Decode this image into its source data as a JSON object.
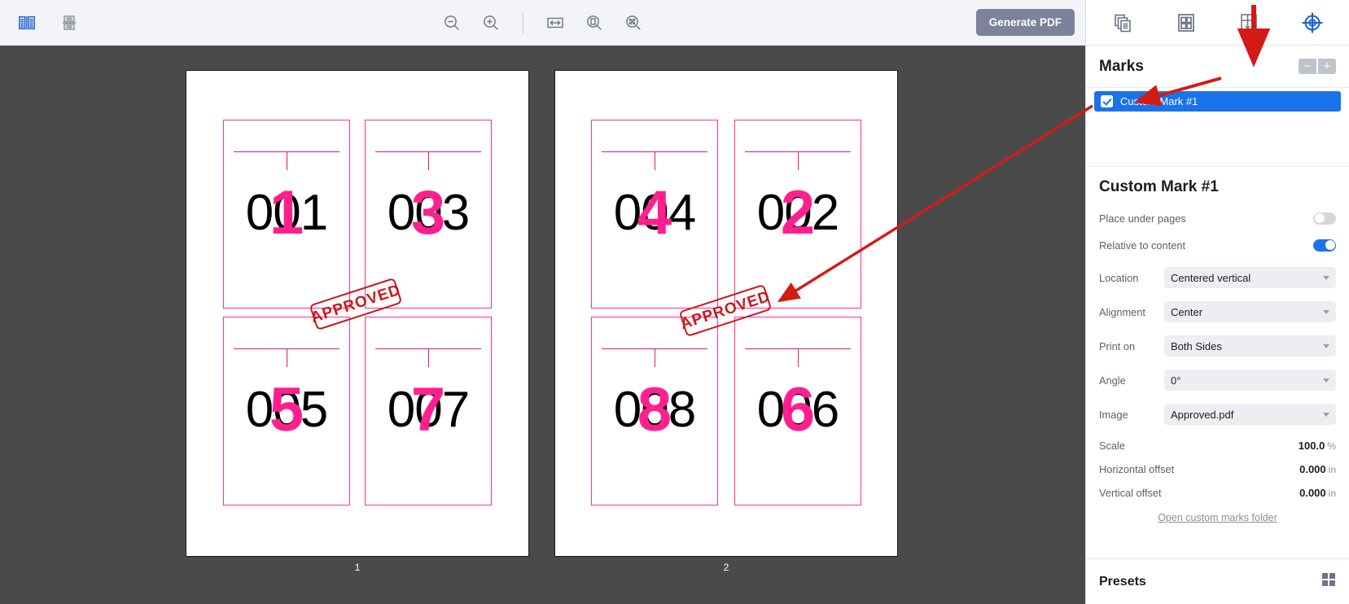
{
  "toolbar": {
    "left_icons": [
      {
        "name": "two-page-spread-icon",
        "label": "Spread view"
      },
      {
        "name": "save-icon",
        "label": "Save"
      }
    ],
    "center_icons": [
      {
        "name": "zoom-out-icon",
        "label": "Zoom out"
      },
      {
        "name": "zoom-in-icon",
        "label": "Zoom in"
      },
      {
        "name": "fit-width-icon",
        "label": "Fit width"
      },
      {
        "name": "fit-page-icon",
        "label": "Fit page"
      },
      {
        "name": "fit-all-icon",
        "label": "Fit all"
      }
    ],
    "generate_button": "Generate PDF"
  },
  "canvas": {
    "sheets": [
      {
        "label": "1",
        "stamp": "APPROVED",
        "cells": [
          {
            "black": "001",
            "pink": "1"
          },
          {
            "black": "003",
            "pink": "3"
          },
          {
            "black": "005",
            "pink": "5"
          },
          {
            "black": "007",
            "pink": "7"
          }
        ]
      },
      {
        "label": "2",
        "stamp": "APPROVED",
        "cells": [
          {
            "black": "004",
            "pink": "4"
          },
          {
            "black": "002",
            "pink": "2"
          },
          {
            "black": "008",
            "pink": "8"
          },
          {
            "black": "006",
            "pink": "6"
          }
        ]
      }
    ]
  },
  "panel": {
    "tabs": [
      {
        "name": "pages-tab",
        "label": "Pages",
        "active": false
      },
      {
        "name": "imposition-tab",
        "label": "Imposition",
        "active": false
      },
      {
        "name": "layout-tab",
        "label": "Layout",
        "active": false
      },
      {
        "name": "marks-tab",
        "label": "Marks",
        "active": true
      }
    ],
    "marks_header": "Marks",
    "remove_mark_label": "−",
    "add_mark_label": "+",
    "marks_list": [
      {
        "label": "Custom Mark #1",
        "checked": true,
        "selected": true
      }
    ],
    "properties": {
      "title": "Custom Mark #1",
      "place_under_pages": {
        "label": "Place under pages",
        "on": false
      },
      "relative_to_content": {
        "label": "Relative to content",
        "on": true
      },
      "location": {
        "label": "Location",
        "value": "Centered vertical"
      },
      "alignment": {
        "label": "Alignment",
        "value": "Center"
      },
      "print_on": {
        "label": "Print on",
        "value": "Both Sides"
      },
      "angle": {
        "label": "Angle",
        "value": "0°"
      },
      "image": {
        "label": "Image",
        "value": "Approved.pdf"
      },
      "scale": {
        "label": "Scale",
        "value": "100.0",
        "unit": "%"
      },
      "horizontal_offset": {
        "label": "Horizontal offset",
        "value": "0.000",
        "unit": "in"
      },
      "vertical_offset": {
        "label": "Vertical offset",
        "value": "0.000",
        "unit": "in"
      },
      "open_folder_link": "Open custom marks folder"
    },
    "presets_header": "Presets"
  },
  "colors": {
    "accent_blue": "#1a73e8",
    "mark_pink": "#ff1f8e",
    "stamp_red": "#c9191c",
    "annotation_red": "#d31b16",
    "canvas_gray": "#4a4a4a",
    "toolbar_gray": "#f2f4f7",
    "generate_btn": "#7b8299"
  }
}
